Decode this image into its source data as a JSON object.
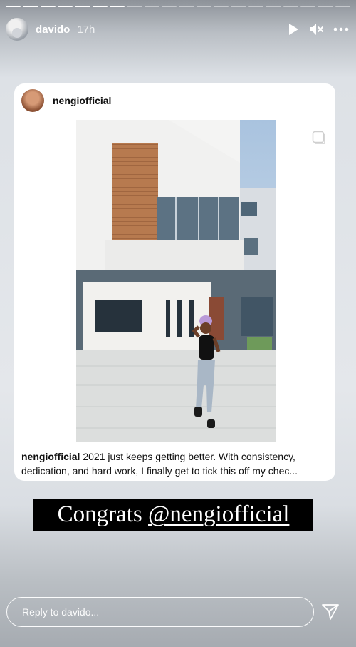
{
  "story": {
    "segments_total": 20,
    "segments_viewed": 7,
    "username": "davido",
    "time_ago": "17h",
    "icons": [
      "play-icon",
      "mute-icon",
      "more-icon"
    ]
  },
  "post": {
    "username": "nengiofficial",
    "caption_user": "nengiofficial",
    "caption_text": " 2021 just keeps getting better. With consistency, dedication, and hard work, I finally get to tick this off my chec..."
  },
  "overlay": {
    "congrats_text": "Congrats ",
    "mention": "@nengiofficial"
  },
  "reply": {
    "placeholder": "Reply to davido..."
  }
}
